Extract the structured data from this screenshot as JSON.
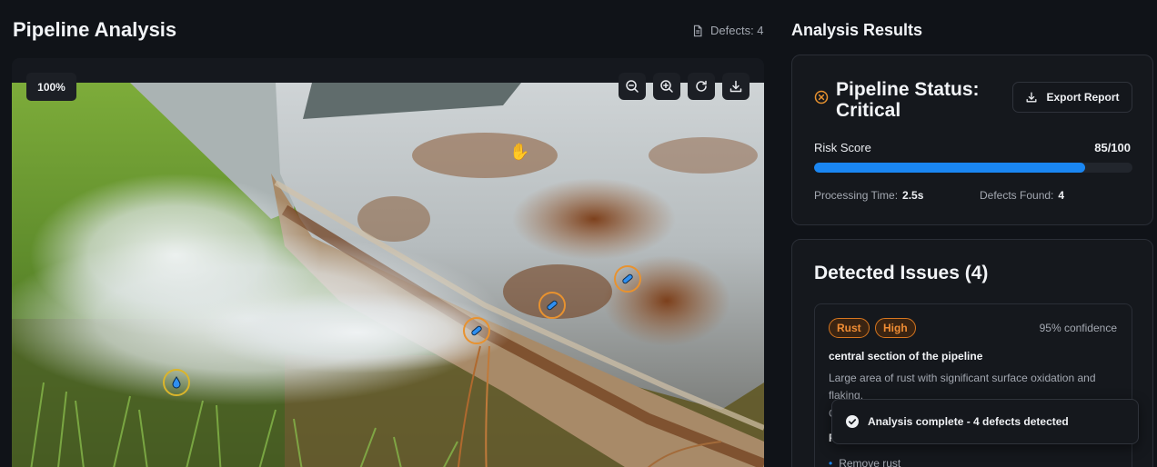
{
  "left": {
    "title": "Pipeline Analysis",
    "defects_label": "Defects: 4",
    "zoom": "100%"
  },
  "toolbar": {
    "zoom_out": "zoom-out-icon",
    "zoom_in": "zoom-in-icon",
    "reset": "refresh-icon",
    "download": "download-icon"
  },
  "markers": [
    {
      "type": "rust",
      "icon": "pill-icon",
      "color": "#e8922f"
    },
    {
      "type": "crack",
      "icon": "pill-icon",
      "color": "#e8922f"
    },
    {
      "type": "corrosion",
      "icon": "pill-icon",
      "color": "#e8922f"
    },
    {
      "type": "leak",
      "icon": "droplet-icon",
      "color": "#dab52b"
    }
  ],
  "right": {
    "title": "Analysis Results",
    "status": {
      "title": "Pipeline Status: Critical",
      "export_label": "Export Report",
      "risk_label": "Risk Score",
      "risk_value": "85/100",
      "risk_fraction": 0.85,
      "processing_label": "Processing Time:",
      "processing_value": "2.5s",
      "defects_label": "Defects Found:",
      "defects_value": "4"
    },
    "issues": {
      "title": "Detected Issues (4)",
      "item": {
        "type_tag": "Rust",
        "severity_tag": "High",
        "confidence": "95% confidence",
        "location": "central section of the pipeline",
        "description": "Large area of rust with significant surface oxidation and flaking.",
        "partial_line": "C",
        "recommendations_heading": "R",
        "recommendation_1": "Remove rust"
      }
    }
  },
  "toast": {
    "message": "Analysis complete - 4 defects detected"
  },
  "colors": {
    "accent": "#1a86f2",
    "critical": "#e8922f",
    "background": "#101318"
  }
}
